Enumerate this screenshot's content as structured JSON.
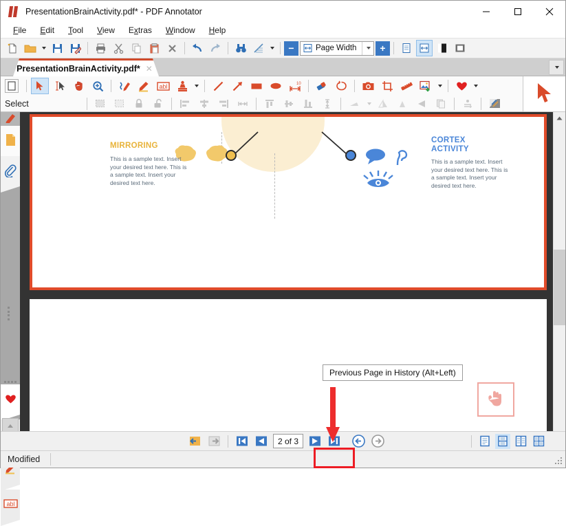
{
  "window": {
    "title": "PresentationBrainActivity.pdf* - PDF Annotator",
    "logo_icon": "pdf-annotator-logo-icon",
    "minimize_label": "—",
    "maximize_label": "□",
    "close_label": "✕"
  },
  "menu": {
    "items": [
      {
        "label": "File",
        "accel": "F"
      },
      {
        "label": "Edit",
        "accel": "E"
      },
      {
        "label": "Tool",
        "accel": "T"
      },
      {
        "label": "View",
        "accel": "V"
      },
      {
        "label": "Extras",
        "accel": "x"
      },
      {
        "label": "Window",
        "accel": "W"
      },
      {
        "label": "Help",
        "accel": "H"
      }
    ]
  },
  "toolbar_main": {
    "buttons": [
      {
        "name": "new-document-icon",
        "title": "New"
      },
      {
        "name": "open-folder-icon",
        "title": "Open"
      },
      {
        "name": "open-dropdown-caret-icon",
        "title": "Open options"
      },
      {
        "name": "save-icon",
        "title": "Save"
      },
      {
        "name": "save-as-icon",
        "title": "Save As"
      },
      {
        "name": "print-icon",
        "title": "Print"
      },
      {
        "name": "cut-scissors-icon",
        "title": "Cut"
      },
      {
        "name": "copy-icon",
        "title": "Copy"
      },
      {
        "name": "paste-icon",
        "title": "Paste"
      },
      {
        "name": "delete-x-icon",
        "title": "Delete"
      },
      {
        "name": "undo-icon",
        "title": "Undo"
      },
      {
        "name": "redo-icon",
        "title": "Redo"
      },
      {
        "name": "find-binoculars-icon",
        "title": "Find"
      },
      {
        "name": "grid-tool-icon",
        "title": "Grid"
      },
      {
        "name": "grid-dropdown-caret-icon",
        "title": "Grid options"
      }
    ],
    "zoom": {
      "minus_label": "−",
      "plus_label": "+",
      "value": "Page Width",
      "page_icon": "page-width-icon",
      "dropdown_icon": "chevron-down-icon"
    },
    "view_buttons": [
      {
        "name": "single-page-view-icon",
        "active": false
      },
      {
        "name": "page-width-view-icon",
        "active": true
      },
      {
        "name": "full-screen-view-icon",
        "active": false
      },
      {
        "name": "presentation-view-icon",
        "active": false
      }
    ]
  },
  "document_tab": {
    "name": "PresentationBrainActivity.pdf*",
    "close_label": "✕",
    "tab_list_icon": "chevron-down-icon"
  },
  "toolbar_annotate": {
    "select_label": "Select",
    "tools": [
      {
        "name": "select-arrow-icon",
        "active": true
      },
      {
        "name": "text-select-icon",
        "active": false
      },
      {
        "name": "hand-pan-icon",
        "active": false
      },
      {
        "name": "zoom-magnifier-icon",
        "active": false
      },
      {
        "name": "pen-icon",
        "active": false
      },
      {
        "name": "highlighter-icon",
        "active": false
      },
      {
        "name": "text-box-abl-icon",
        "active": false
      },
      {
        "name": "stamp-icon",
        "active": false
      },
      {
        "name": "stamp-dropdown-caret-icon",
        "active": false
      },
      {
        "name": "line-icon",
        "active": false
      },
      {
        "name": "arrow-icon",
        "active": false
      },
      {
        "name": "rectangle-icon",
        "active": false
      },
      {
        "name": "ellipse-icon",
        "active": false
      },
      {
        "name": "measure-icon",
        "active": false
      },
      {
        "name": "eraser-icon",
        "active": false
      },
      {
        "name": "lasso-icon",
        "active": false
      },
      {
        "name": "snapshot-camera-icon",
        "active": false
      },
      {
        "name": "crop-icon",
        "active": false
      },
      {
        "name": "ruler-icon",
        "active": false
      },
      {
        "name": "add-image-icon",
        "active": false
      },
      {
        "name": "add-image-dropdown-caret-icon",
        "active": false
      },
      {
        "name": "favorite-heart-icon",
        "active": false
      },
      {
        "name": "favorite-dropdown-caret-icon",
        "active": false
      }
    ],
    "arrange_tools": [
      {
        "name": "select-all-icon"
      },
      {
        "name": "deselect-icon"
      },
      {
        "name": "lock-icon"
      },
      {
        "name": "unlock-icon"
      },
      {
        "name": "align-left-icon"
      },
      {
        "name": "align-center-icon"
      },
      {
        "name": "align-right-icon"
      },
      {
        "name": "distribute-horizontal-icon"
      },
      {
        "name": "align-top-icon"
      },
      {
        "name": "align-middle-icon"
      },
      {
        "name": "align-bottom-icon"
      },
      {
        "name": "distribute-vertical-icon"
      },
      {
        "name": "rotate-icon"
      },
      {
        "name": "rotate-dropdown-caret-icon"
      },
      {
        "name": "flip-horizontal-icon"
      },
      {
        "name": "flip-vertical-icon"
      },
      {
        "name": "mirror-icon"
      },
      {
        "name": "duplicate-icon"
      },
      {
        "name": "group-icon"
      },
      {
        "name": "properties-icon"
      }
    ],
    "cursor_panel_icon": "large-cursor-arrow-icon"
  },
  "sidebar": {
    "tabs": [
      {
        "name": "sidebar-tab-pen",
        "icon": "red-pen-icon",
        "active": false
      },
      {
        "name": "sidebar-tab-pages",
        "icon": "page-thumbnail-icon",
        "active": true
      },
      {
        "name": "sidebar-tab-attachments",
        "icon": "paperclip-icon",
        "active": false
      },
      {
        "name": "sidebar-tab-favorites",
        "icon": "heart-icon",
        "active": true
      },
      {
        "name": "sidebar-tab-pen2",
        "icon": "blue-pen-icon",
        "active": false
      },
      {
        "name": "sidebar-tab-highlighter",
        "icon": "highlighter-icon",
        "active": false
      },
      {
        "name": "sidebar-tab-textbox",
        "icon": "text-box-abl-icon",
        "active": false
      }
    ],
    "scroll_up_icon": "chevron-up-icon",
    "scroll_down_icon": "chevron-down-icon"
  },
  "document": {
    "page1": {
      "mirroring": {
        "title": "MIRRORING",
        "body": "This is a sample text. Insert your desired text here. This is a sample text. Insert your desired text here.",
        "color": "#e8b33a"
      },
      "cortex": {
        "title": "CORTEX ACTIVITY",
        "body": "This is a sample text. Insert your desired text here. This is a sample text. Insert your desired text here.",
        "color": "#4a86d8"
      },
      "icons": [
        {
          "name": "brain-left-icon"
        },
        {
          "name": "brain-right-icon"
        },
        {
          "name": "speech-bubble-icon"
        },
        {
          "name": "ear-icon"
        },
        {
          "name": "eye-icon"
        },
        {
          "name": "head-profile-icon"
        },
        {
          "name": "node-yellow-icon"
        },
        {
          "name": "node-blue-icon"
        }
      ]
    }
  },
  "annotations": {
    "tooltip_text": "Previous Page in History (Alt+Left)",
    "arrow_icon": "red-down-arrow-annotation-icon",
    "arrow_color": "#ed2d2d",
    "hand_stamp_icon": "hand-stamp-icon",
    "highlight_color": "#ed1c24"
  },
  "navbar": {
    "buttons": [
      {
        "name": "previous-view-icon"
      },
      {
        "name": "next-view-icon"
      },
      {
        "name": "first-page-icon"
      },
      {
        "name": "previous-page-icon"
      },
      {
        "name": "next-page-icon"
      },
      {
        "name": "last-page-icon"
      },
      {
        "name": "back-history-icon"
      },
      {
        "name": "forward-history-icon"
      }
    ],
    "page_indicator": "2 of 3",
    "current_page": 2,
    "total_pages": 3,
    "view_modes": [
      {
        "name": "view-mode-single",
        "active": false
      },
      {
        "name": "view-mode-continuous",
        "active": true
      },
      {
        "name": "view-mode-facing",
        "active": false
      },
      {
        "name": "view-mode-facing-continuous",
        "active": false
      }
    ]
  },
  "statusbar": {
    "text": "Modified",
    "resize_grip_icon": "resize-grip-icon"
  }
}
